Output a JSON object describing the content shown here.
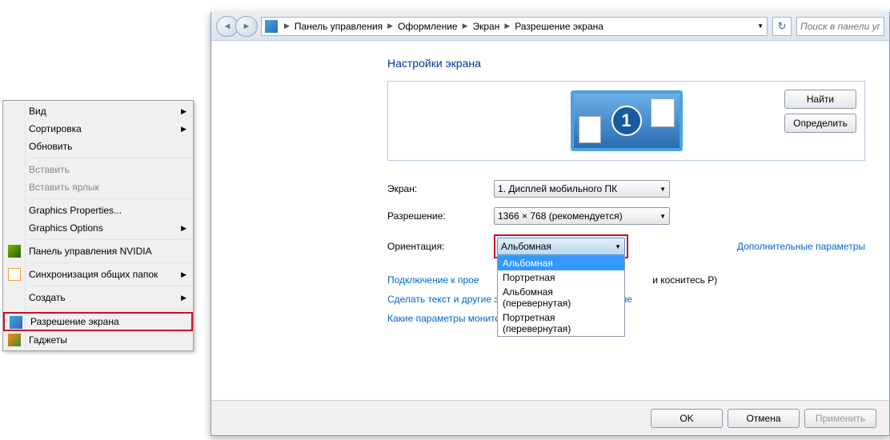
{
  "context_menu": {
    "items": [
      {
        "label": "Вид",
        "submenu": true
      },
      {
        "label": "Сортировка",
        "submenu": true
      },
      {
        "label": "Обновить"
      },
      {
        "sep": true
      },
      {
        "label": "Вставить",
        "disabled": true
      },
      {
        "label": "Вставить ярлык",
        "disabled": true
      },
      {
        "sep": true
      },
      {
        "label": "Graphics Properties..."
      },
      {
        "label": "Graphics Options",
        "submenu": true
      },
      {
        "sep": true
      },
      {
        "label": "Панель управления NVIDIA",
        "icon": "nvidia"
      },
      {
        "sep": true
      },
      {
        "label": "Синхронизация общих папок",
        "submenu": true,
        "icon": "sync"
      },
      {
        "sep": true
      },
      {
        "label": "Создать",
        "submenu": true
      },
      {
        "sep": true
      },
      {
        "label": "Разрешение экрана",
        "icon": "resolution",
        "highlight": true
      },
      {
        "label": "Гаджеты",
        "icon": "gadgets"
      }
    ]
  },
  "breadcrumb": {
    "items": [
      "Панель управления",
      "Оформление",
      "Экран",
      "Разрешение экрана"
    ]
  },
  "search_placeholder": "Поиск в панели упр",
  "page": {
    "title": "Настройки экрана",
    "find_btn": "Найти",
    "detect_btn": "Определить",
    "monitor_number": "1",
    "screen_label": "Экран:",
    "screen_value": "1. Дисплей мобильного ПК",
    "resolution_label": "Разрешение:",
    "resolution_value": "1366 × 768 (рекомендуется)",
    "orientation_label": "Ориентация:",
    "orientation_value": "Альбомная",
    "orientation_options": [
      "Альбомная",
      "Портретная",
      "Альбомная (перевернутая)",
      "Портретная (перевернутая)"
    ],
    "advanced_link": "Дополнительные параметры",
    "projector_prefix": "Подключение к прое",
    "projector_suffix": "и коснитесь P)",
    "text_size_link": "Сделать текст и другие элементы больше или меньше",
    "which_monitor_link": "Какие параметры монитора следует выбрать?"
  },
  "footer": {
    "ok": "OK",
    "cancel": "Отмена",
    "apply": "Применить"
  }
}
